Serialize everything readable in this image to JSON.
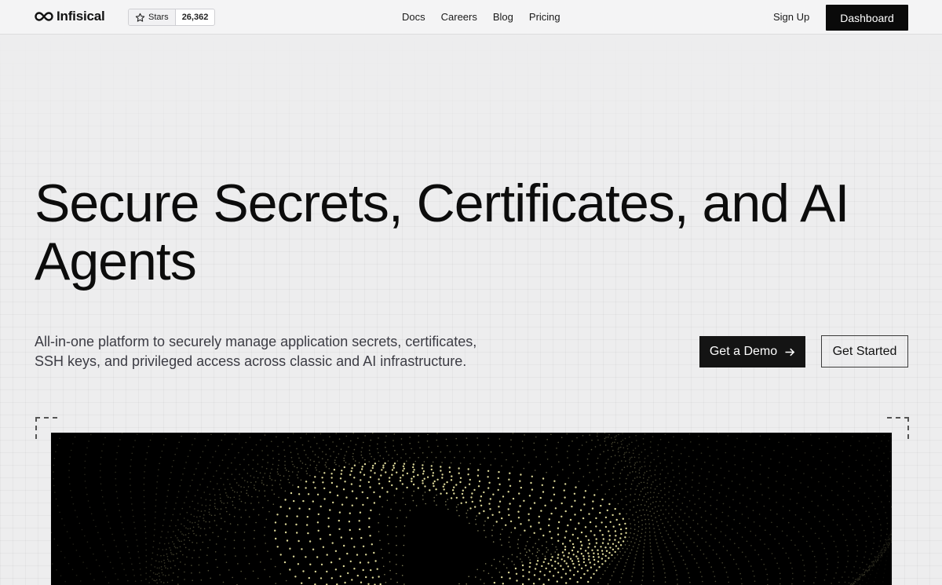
{
  "header": {
    "logo_text": "Infisical",
    "github": {
      "stars_label": "Stars",
      "stars_count": "26,362"
    },
    "nav": [
      "Docs",
      "Careers",
      "Blog",
      "Pricing"
    ],
    "signup_label": "Sign Up",
    "dashboard_label": "Dashboard"
  },
  "hero": {
    "title": "Secure Secrets, Certificates, and AI Agents",
    "subtitle": "All-in-one platform to securely manage application secrets, certificates, SSH keys, and privileged access across classic and AI infrastructure.",
    "demo_label": "Get a Demo",
    "started_label": "Get Started"
  },
  "colors": {
    "background": "#ededee",
    "primary_button": "#141414",
    "visual_bg": "#000000",
    "particle": "#e8e3a0"
  },
  "icons": [
    "infinity-logo-icon",
    "star-icon",
    "arrow-right-icon"
  ]
}
